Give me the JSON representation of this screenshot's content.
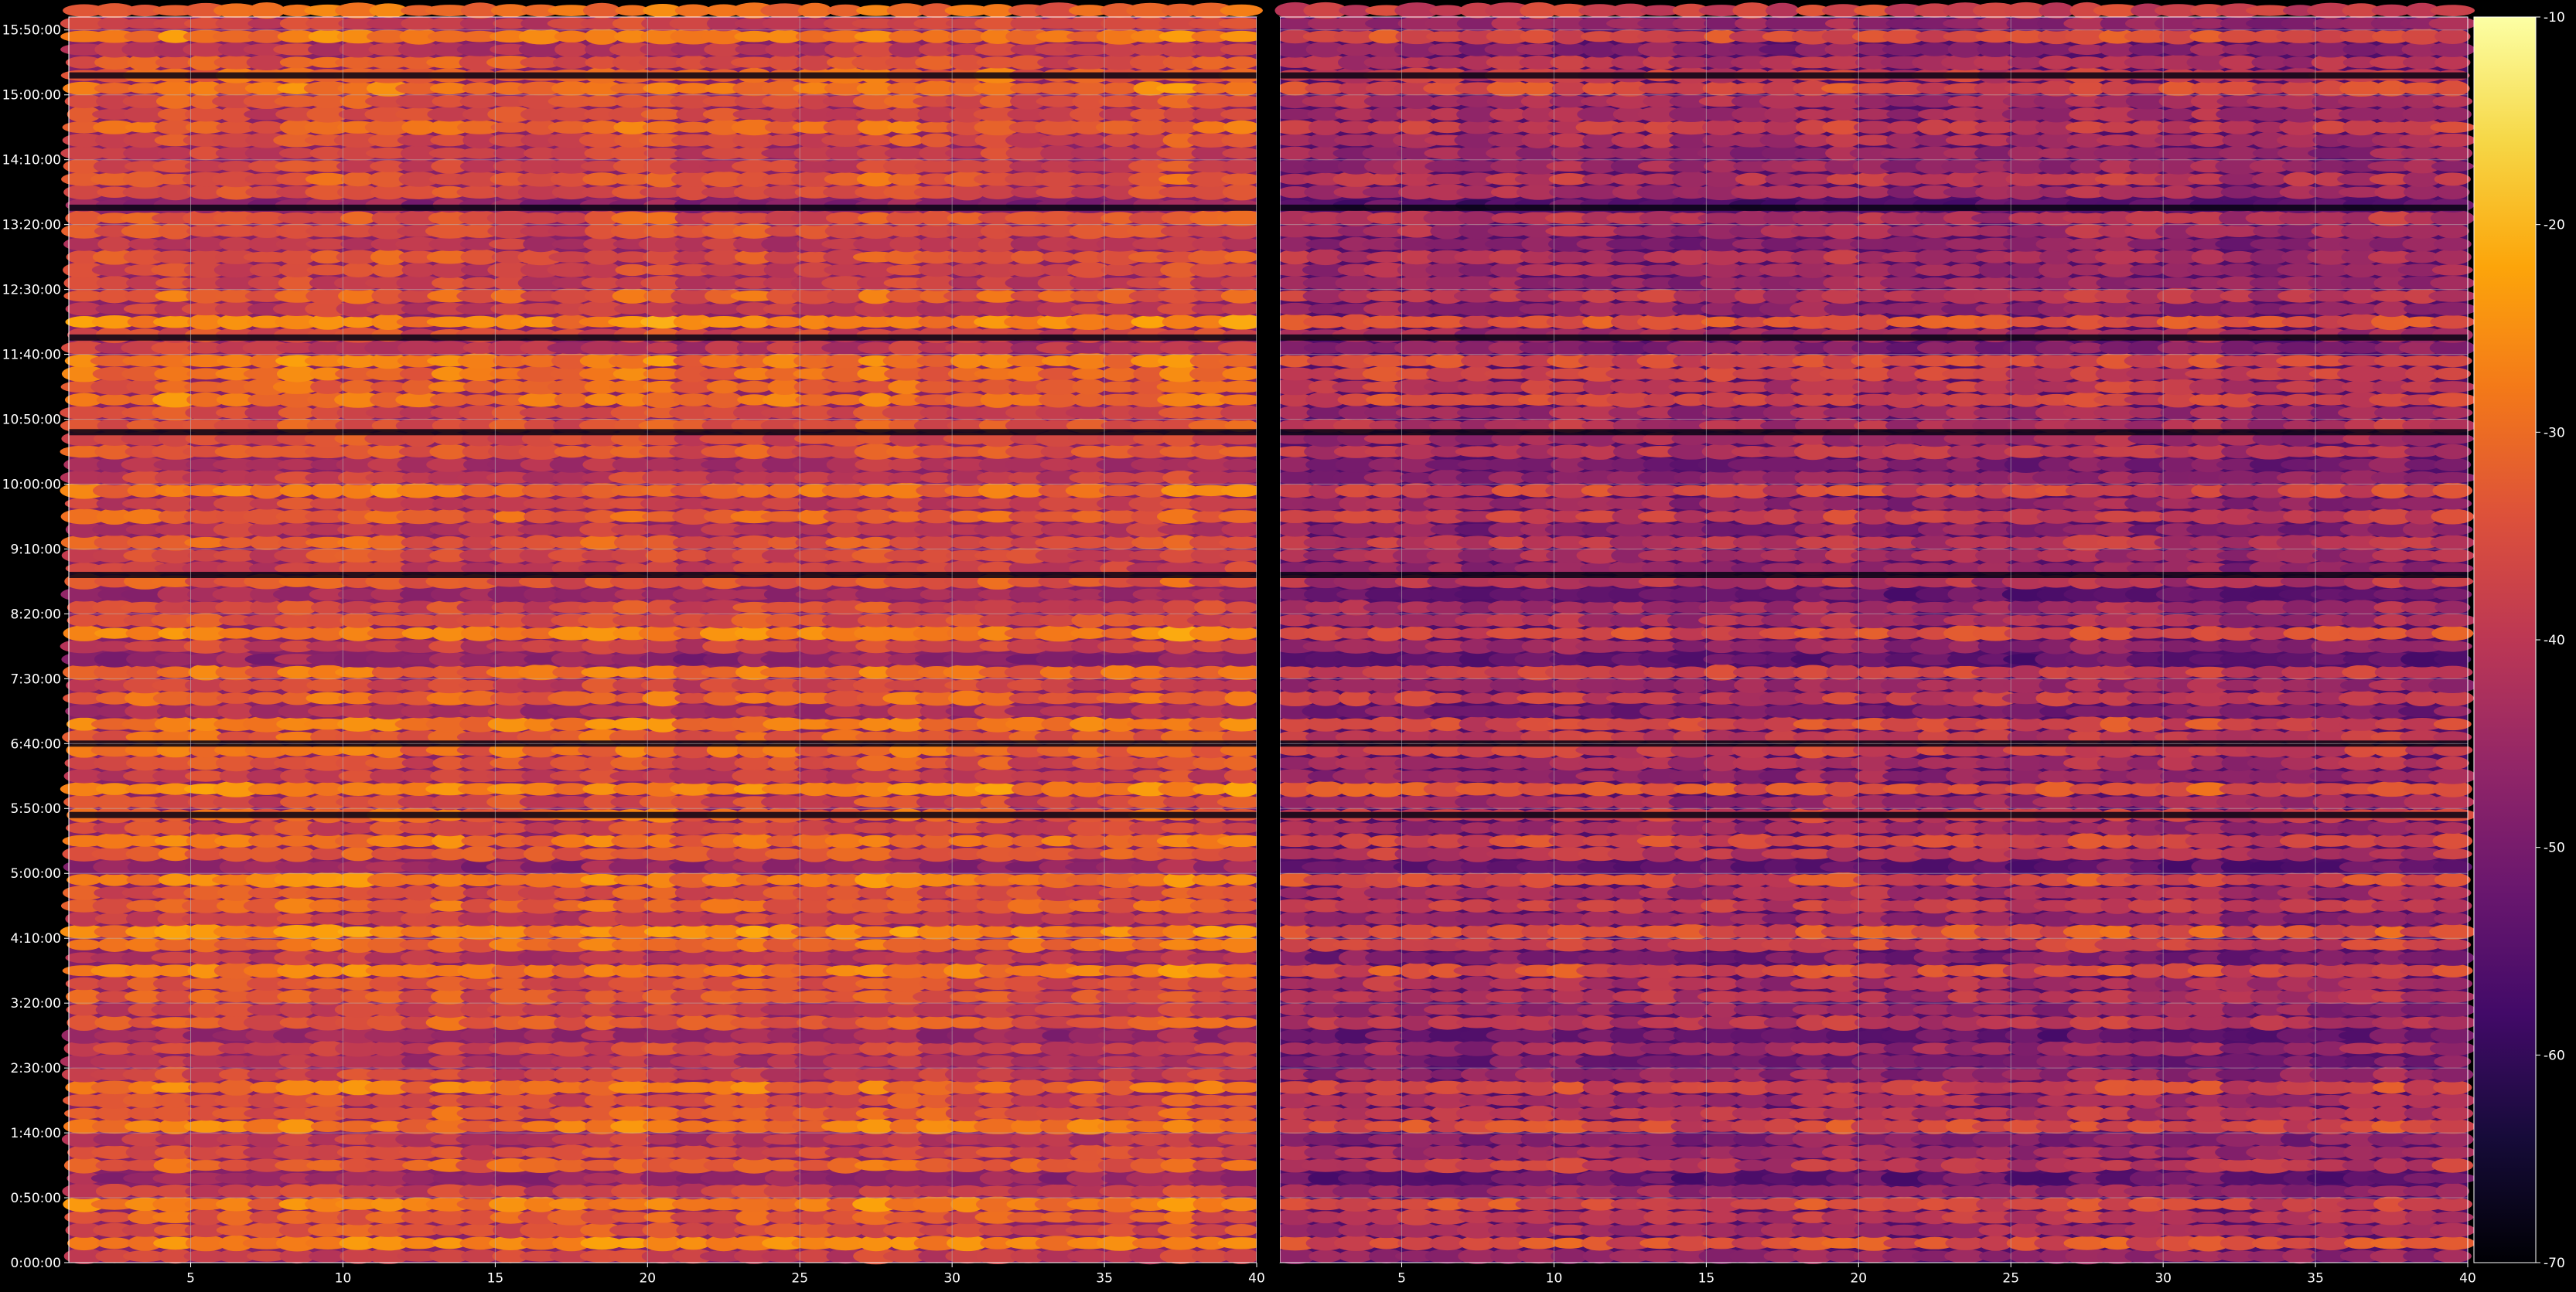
{
  "colors": {
    "background": "#000000",
    "grid": "#b8b8b8",
    "axis": "#ffffff",
    "divider": "#000000"
  },
  "chart_data": {
    "type": "heatmap",
    "colormap": "inferno",
    "grid": true,
    "panels": [
      {
        "name": "left",
        "xlim": [
          1,
          40
        ],
        "x_ticks": [
          "5",
          "10",
          "15",
          "20",
          "25",
          "30",
          "35",
          "40"
        ],
        "x_tick_values": [
          5,
          10,
          15,
          20,
          25,
          30,
          35,
          40
        ],
        "level_offset_db": 0
      },
      {
        "name": "right",
        "xlim": [
          1,
          40
        ],
        "x_ticks": [
          "5",
          "10",
          "15",
          "20",
          "25",
          "30",
          "35",
          "40"
        ],
        "x_tick_values": [
          5,
          10,
          15,
          20,
          25,
          30,
          35,
          40
        ],
        "level_offset_db": -8
      }
    ],
    "y_axis": {
      "unit": "minutes",
      "range": [
        0,
        960
      ],
      "ticks": [
        "0:00:00",
        "0:50:00",
        "1:40:00",
        "2:30:00",
        "3:20:00",
        "4:10:00",
        "5:00:00",
        "5:50:00",
        "6:40:00",
        "7:30:00",
        "8:20:00",
        "9:10:00",
        "10:00:00",
        "10:50:00",
        "11:40:00",
        "12:30:00",
        "13:20:00",
        "14:10:00",
        "15:00:00",
        "15:50:00"
      ],
      "tick_values": [
        0,
        50,
        100,
        150,
        200,
        250,
        300,
        350,
        400,
        450,
        500,
        550,
        600,
        650,
        700,
        750,
        800,
        850,
        900,
        950
      ]
    },
    "colorbar": {
      "range": [
        -70,
        -10
      ],
      "ticks": [
        "-10",
        "-20",
        "-30",
        "-40",
        "-50",
        "-60",
        "-70"
      ],
      "tick_values": [
        -10,
        -20,
        -30,
        -40,
        -50,
        -60,
        -70
      ]
    },
    "row_levels_db": {
      "row_step_minutes": 10,
      "start_minutes": 0,
      "values": [
        -38,
        -27,
        -35,
        -33,
        -28,
        -38,
        -45,
        -32,
        -36,
        -40,
        -28,
        -33,
        -35,
        -29,
        -38,
        -42,
        -37,
        -45,
        -33,
        -38,
        -34,
        -35,
        -28,
        -41,
        -30,
        -26,
        -38,
        -31,
        -35,
        -28,
        -46,
        -33,
        -29,
        -37,
        -31,
        -36,
        -26,
        -38,
        -35,
        -30,
        -32,
        -28,
        -42,
        -31,
        -37,
        -30,
        -46,
        -38,
        -27,
        -35,
        -36,
        -45,
        -34,
        -38,
        -36,
        -33,
        -40,
        -31,
        -38,
        -29,
        -39,
        -42,
        -33,
        -36,
        -34,
        -37,
        -29,
        -32,
        -30,
        -28,
        -40,
        -36,
        -26,
        -39,
        -32,
        -38,
        -37,
        -34,
        -40,
        -35,
        -34,
        -47,
        -36,
        -33,
        -37,
        -38,
        -35,
        -31,
        -36,
        -35,
        -28,
        -31,
        -34,
        -40,
        -28,
        -38,
        -30,
        -41
      ]
    },
    "dark_bands_minutes": [
      345,
      400,
      530,
      640,
      713,
      813,
      915
    ]
  }
}
